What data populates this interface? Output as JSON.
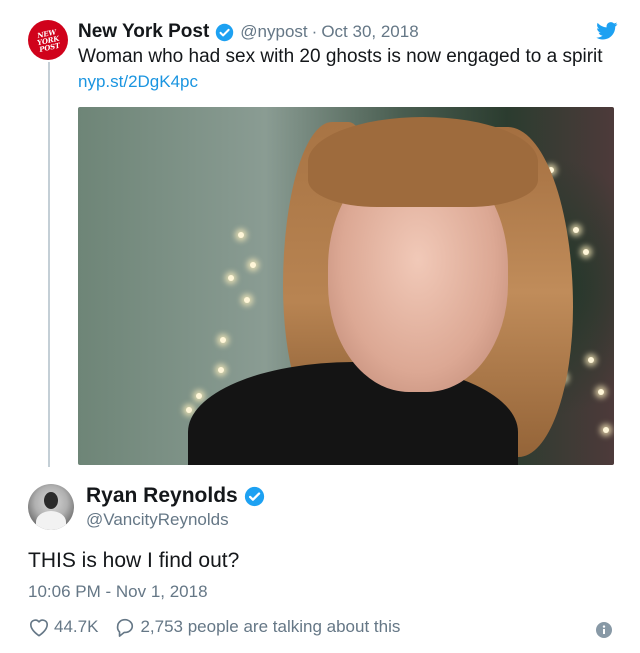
{
  "quoted_tweet": {
    "author_name": "New York Post",
    "handle": "@nypost",
    "date": "Oct 30, 2018",
    "text": "Woman who had sex with 20 ghosts is now engaged to a spirit",
    "link": "nyp.st/2DgK4pc",
    "avatar_logo_text": [
      "NEW",
      "YORK",
      "POST"
    ]
  },
  "tweet": {
    "author_name": "Ryan Reynolds",
    "handle": "@VancityReynolds",
    "text": "THIS is how I find out?",
    "timestamp": "10:06 PM - Nov 1, 2018",
    "likes": "44.7K",
    "replies_text": "2,753 people are talking about this"
  },
  "icons": {
    "verified": "verified-badge-icon",
    "twitter": "twitter-bird-icon",
    "like": "heart-icon",
    "reply": "speech-bubble-icon",
    "info": "info-icon"
  },
  "colors": {
    "twitter_blue": "#1da1f2",
    "link_blue": "#1b95e0",
    "secondary_text": "#657786",
    "nyp_red": "#d0021b"
  }
}
